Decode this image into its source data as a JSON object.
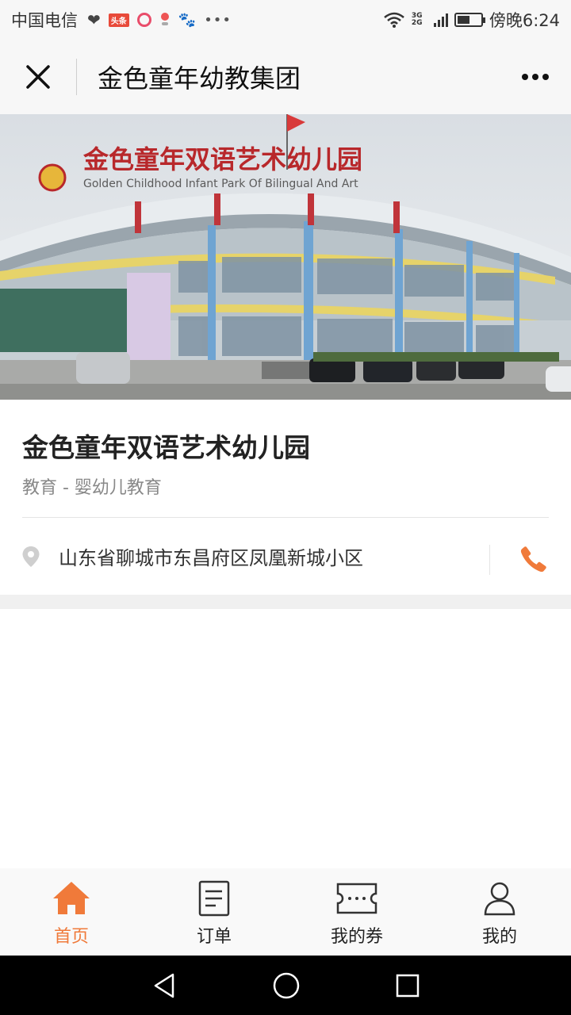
{
  "status_bar": {
    "carrier": "中国电信",
    "notif_badge": "头条",
    "network": "3G 2G",
    "time": "傍晚6:24",
    "battery_level": 0.55
  },
  "header": {
    "title": "金色童年幼教集团"
  },
  "banner": {
    "sign_cn": "金色童年双语艺术幼儿园",
    "sign_en": "Golden Childhood Infant Park Of Bilingual And Art"
  },
  "shop": {
    "name": "金色童年双语艺术幼儿园",
    "category": "教育 - 婴幼儿教育",
    "address": "山东省聊城市东昌府区凤凰新城小区"
  },
  "tabs": [
    {
      "label": "首页",
      "icon": "home-icon",
      "active": true
    },
    {
      "label": "订单",
      "icon": "order-icon",
      "active": false
    },
    {
      "label": "我的券",
      "icon": "coupon-icon",
      "active": false
    },
    {
      "label": "我的",
      "icon": "user-icon",
      "active": false
    }
  ],
  "colors": {
    "accent": "#f07a3a",
    "phone": "#f07a3a"
  }
}
